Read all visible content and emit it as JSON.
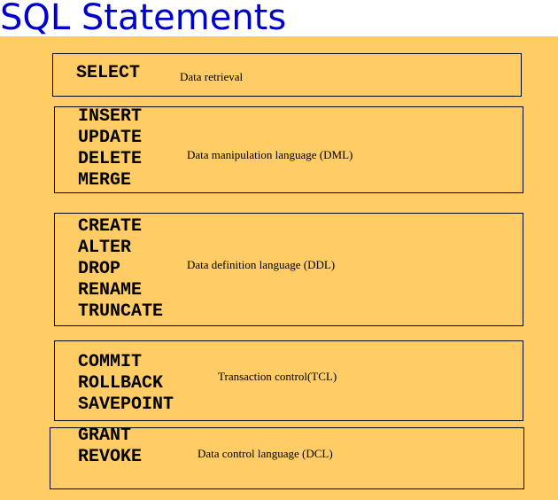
{
  "title": "SQL Statements",
  "colors": {
    "title": "#0000cc",
    "panel": "#ffcc66",
    "border": "#000000"
  },
  "groups": [
    {
      "keywords": [
        "SELECT"
      ],
      "description": "Data retrieval"
    },
    {
      "keywords": [
        "INSERT",
        "UPDATE",
        "DELETE",
        "MERGE"
      ],
      "description": "Data manipulation language (DML)"
    },
    {
      "keywords": [
        "CREATE",
        "ALTER",
        "DROP",
        "RENAME",
        "TRUNCATE"
      ],
      "description": "Data definition language (DDL)"
    },
    {
      "keywords": [
        "COMMIT",
        "ROLLBACK",
        "SAVEPOINT"
      ],
      "description": "Transaction control(TCL)"
    },
    {
      "keywords": [
        "GRANT",
        "REVOKE"
      ],
      "description": "Data control language (DCL)"
    }
  ]
}
